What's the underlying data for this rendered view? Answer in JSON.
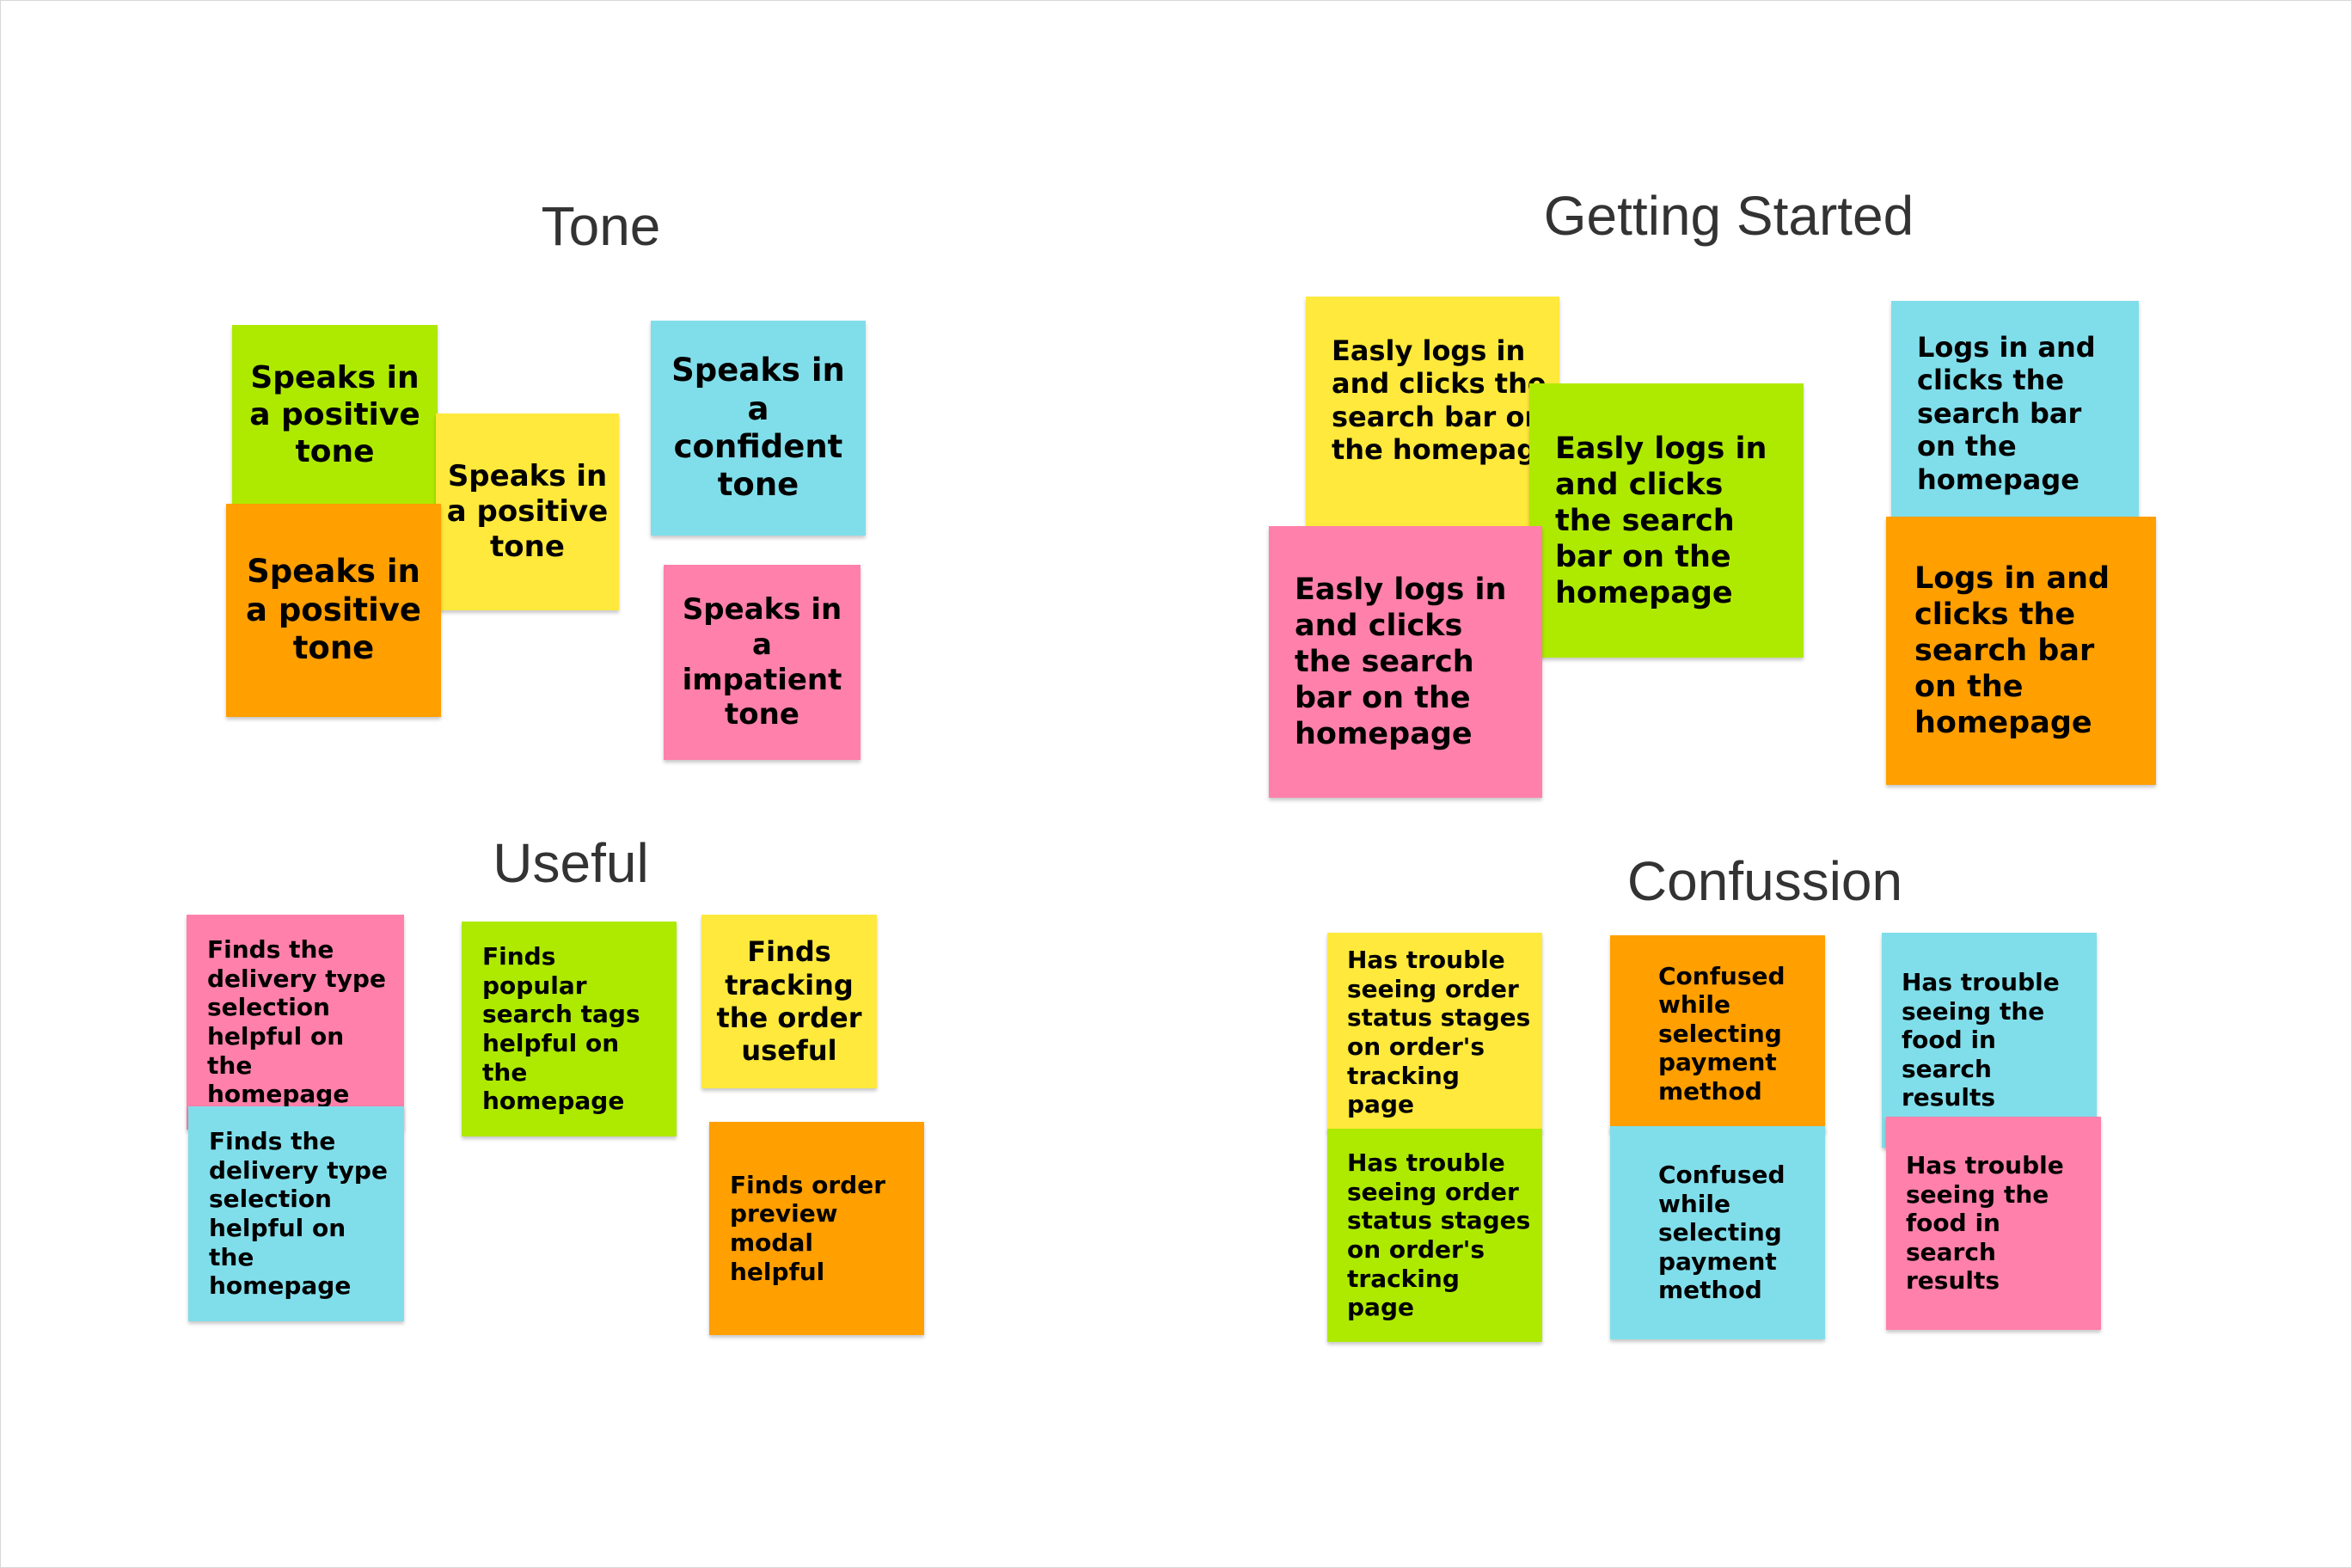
{
  "board": {
    "sections": [
      {
        "title": "Tone",
        "notes": [
          {
            "text": "Speaks in a positive tone",
            "color": "green"
          },
          {
            "text": "Speaks in a positive tone",
            "color": "yellow"
          },
          {
            "text": "Speaks in a positive tone",
            "color": "orange"
          },
          {
            "text": "Speaks in a confident tone",
            "color": "cyan"
          },
          {
            "text": "Speaks in a impatient tone",
            "color": "pink"
          }
        ]
      },
      {
        "title": "Getting Started",
        "notes": [
          {
            "text": "Easly logs in and clicks the search bar on the homepage",
            "color": "yellow"
          },
          {
            "text": "Easly logs in and clicks the search bar on the homepage",
            "color": "green"
          },
          {
            "text": "Easly logs in and clicks the search bar on the homepage",
            "color": "pink"
          },
          {
            "text": "Logs in and clicks the search bar on the homepage",
            "color": "cyan"
          },
          {
            "text": "Logs in and clicks the search bar on the homepage",
            "color": "orange"
          }
        ]
      },
      {
        "title": "Useful",
        "notes": [
          {
            "text": "Finds the delivery type selection helpful on the homepage",
            "color": "pink"
          },
          {
            "text": "Finds the delivery type selection helpful on the homepage",
            "color": "cyan"
          },
          {
            "text": "Finds popular search tags helpful on the homepage",
            "color": "green"
          },
          {
            "text": "Finds tracking the order useful",
            "color": "yellow"
          },
          {
            "text": "Finds order preview modal helpful",
            "color": "orange"
          }
        ]
      },
      {
        "title": "Confussion",
        "notes": [
          {
            "text": "Has trouble seeing order status stages on order's tracking page",
            "color": "yellow"
          },
          {
            "text": "Has trouble seeing order status stages on order's tracking page",
            "color": "green"
          },
          {
            "text": "Confused while selecting payment method",
            "color": "orange"
          },
          {
            "text": "Confused while selecting payment method",
            "color": "cyan"
          },
          {
            "text": "Has trouble seeing the food in search results",
            "color": "cyan"
          },
          {
            "text": "Has trouble seeing the food in search results",
            "color": "pink"
          }
        ]
      }
    ],
    "colors": {
      "yellow": "#FFE93C",
      "green": "#AEEA00",
      "orange": "#FF9F00",
      "cyan": "#80DEEA",
      "pink": "#FF80AB",
      "title_text": "#333333"
    }
  }
}
